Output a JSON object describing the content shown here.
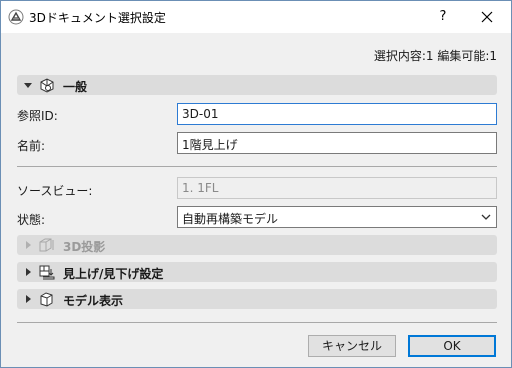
{
  "window": {
    "title": "3Dドキュメント選択設定",
    "help_label": "?"
  },
  "info": {
    "selection_status": "選択内容:1 編集可能:1"
  },
  "sections": {
    "general": {
      "label": "一般",
      "icon": "general-settings-icon"
    },
    "projection": {
      "label": "3D投影",
      "icon": "3d-projection-icon"
    },
    "view_setup": {
      "label": "見上げ/見下げ設定",
      "icon": "floor-view-icon"
    },
    "model_display": {
      "label": "モデル表示",
      "icon": "model-display-icon"
    }
  },
  "fields": {
    "reference_id": {
      "label": "参照ID:",
      "value": "3D-01"
    },
    "name": {
      "label": "名前:",
      "value": "1階見上げ"
    },
    "source_view": {
      "label": "ソースビュー:",
      "value": "1. 1FL"
    },
    "status": {
      "label": "状態:",
      "value": "自動再構築モデル"
    }
  },
  "buttons": {
    "cancel": "キャンセル",
    "ok": "OK"
  },
  "colors": {
    "accent": "#0078d7",
    "focus_border": "#2d7bd3",
    "section_bg": "#dcdcdc",
    "window_bg": "#f0f0f0"
  }
}
